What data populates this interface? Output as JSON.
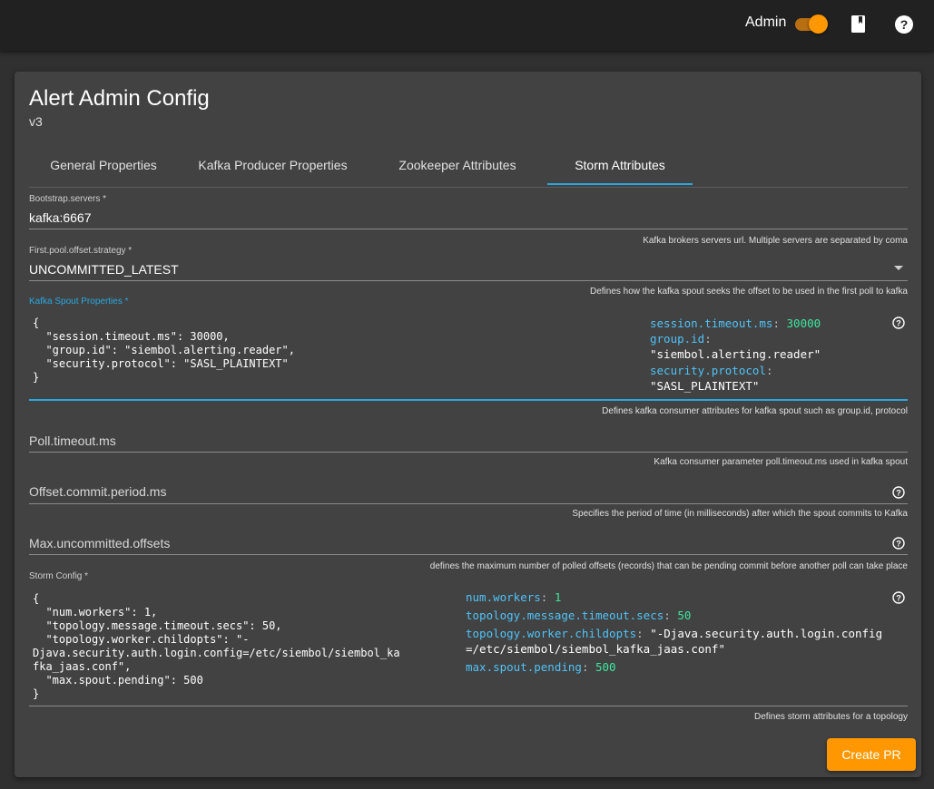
{
  "topbar": {
    "admin_label": "Admin",
    "admin_toggle_on": true,
    "icons": [
      "book-icon",
      "help-circle-icon"
    ]
  },
  "page": {
    "title": "Alert Admin Config",
    "version": "v3"
  },
  "tabs": [
    {
      "label": "General Properties",
      "active": false
    },
    {
      "label": "Kafka Producer Properties",
      "active": false
    },
    {
      "label": "Zookeeper Attributes",
      "active": false
    },
    {
      "label": "Storm Attributes",
      "active": true
    }
  ],
  "fields": {
    "bootstrap": {
      "label": "Bootstrap.servers *",
      "value": "kafka:6667",
      "hint": "Kafka brokers servers url. Multiple servers are separated by coma"
    },
    "offset_strategy": {
      "label": "First.pool.offset.strategy *",
      "value": "UNCOMMITTED_LATEST",
      "hint": "Defines how the kafka spout seeks the offset to be used in the first poll to kafka"
    },
    "spout_props": {
      "label": "Kafka Spout Properties *",
      "raw": "{\n  \"session.timeout.ms\": 30000,\n  \"group.id\": \"siembol.alerting.reader\",\n  \"security.protocol\": \"SASL_PLAINTEXT\"\n}",
      "preview": [
        {
          "key": "session.timeout.ms",
          "value": "30000",
          "type": "number"
        },
        {
          "key": "group.id",
          "value": "\"siembol.alerting.reader\"",
          "type": "string"
        },
        {
          "key": "security.protocol",
          "value": "\"SASL_PLAINTEXT\"",
          "type": "string"
        }
      ],
      "hint": "Defines kafka consumer attributes for kafka spout such as group.id, protocol"
    },
    "poll_timeout": {
      "placeholder": "Poll.timeout.ms",
      "hint": "Kafka consumer parameter poll.timeout.ms used in kafka spout"
    },
    "offset_commit": {
      "placeholder": "Offset.commit.period.ms",
      "hint": "Specifies the period of time (in milliseconds) after which the spout commits to Kafka"
    },
    "max_uncommitted": {
      "placeholder": "Max.uncommitted.offsets",
      "hint": "defines the maximum number of polled offsets (records) that can be pending commit before another poll can take place"
    },
    "storm_config": {
      "label": "Storm Config *",
      "raw": "{\n  \"num.workers\": 1,\n  \"topology.message.timeout.secs\": 50,\n  \"topology.worker.childopts\": \"-\nDjava.security.auth.login.config=/etc/siembol/siembol_ka\nfka_jaas.conf\",\n  \"max.spout.pending\": 500\n}",
      "preview": [
        {
          "key": "num.workers",
          "value": "1",
          "type": "number"
        },
        {
          "key": "topology.message.timeout.secs",
          "value": "50",
          "type": "number"
        },
        {
          "key": "topology.worker.childopts",
          "value": "\"-Djava.security.auth.login.config=/etc/siembol/siembol_kafka_jaas.conf\"",
          "type": "string"
        },
        {
          "key": "max.spout.pending",
          "value": "500",
          "type": "number"
        }
      ],
      "hint": "Defines storm attributes for a topology"
    }
  },
  "actions": {
    "create_pr_label": "Create PR"
  }
}
